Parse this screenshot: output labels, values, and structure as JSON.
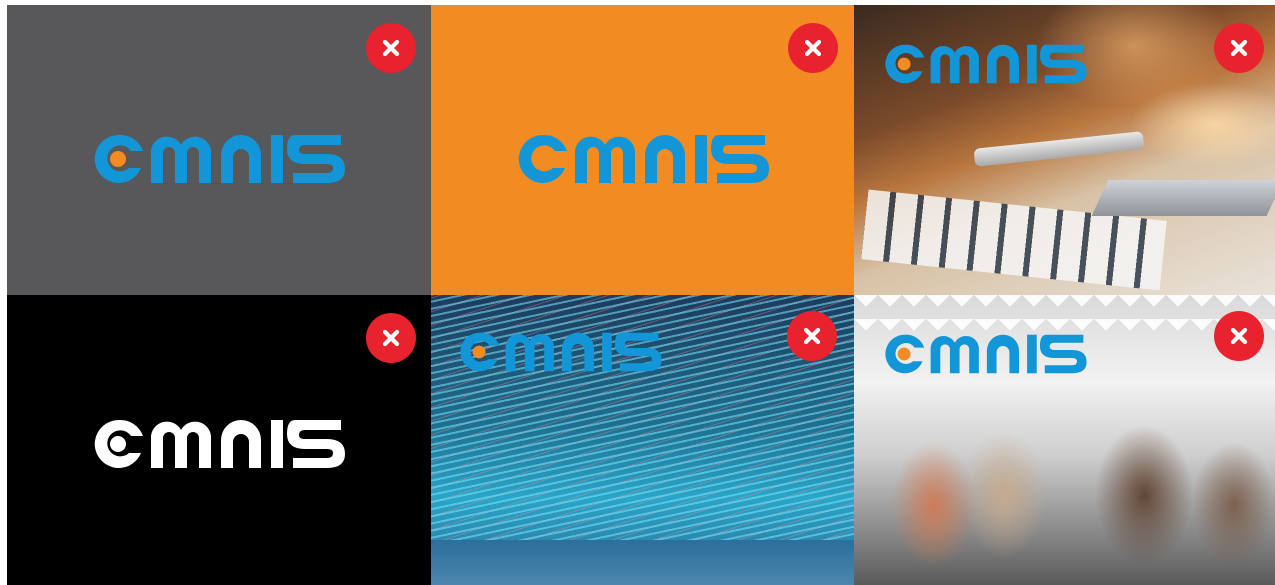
{
  "brand": {
    "name": "omnis",
    "colors": {
      "blue": "#1296d8",
      "orange": "#f28b22",
      "white": "#ffffff",
      "close_red": "#e8232e",
      "tile_gray": "#58585a",
      "tile_orange": "#f28b22",
      "tile_black": "#000000"
    }
  },
  "tiles": [
    {
      "background": "solid-gray",
      "logo_color": "blue",
      "dot_color": "orange",
      "close_icon": "close-icon"
    },
    {
      "background": "solid-orange",
      "logo_color": "blue",
      "dot_color": "blue",
      "close_icon": "close-icon"
    },
    {
      "background": "workspace-photo",
      "logo_color": "blue",
      "dot_color": "orange",
      "close_icon": "close-icon"
    },
    {
      "background": "solid-black",
      "logo_color": "white",
      "dot_color": "white",
      "close_icon": "close-icon"
    },
    {
      "background": "light-streaks-photo",
      "logo_color": "blue",
      "dot_color": "orange",
      "close_icon": "close-icon"
    },
    {
      "background": "office-team-photo",
      "logo_color": "blue",
      "dot_color": "orange",
      "close_icon": "close-icon"
    }
  ]
}
